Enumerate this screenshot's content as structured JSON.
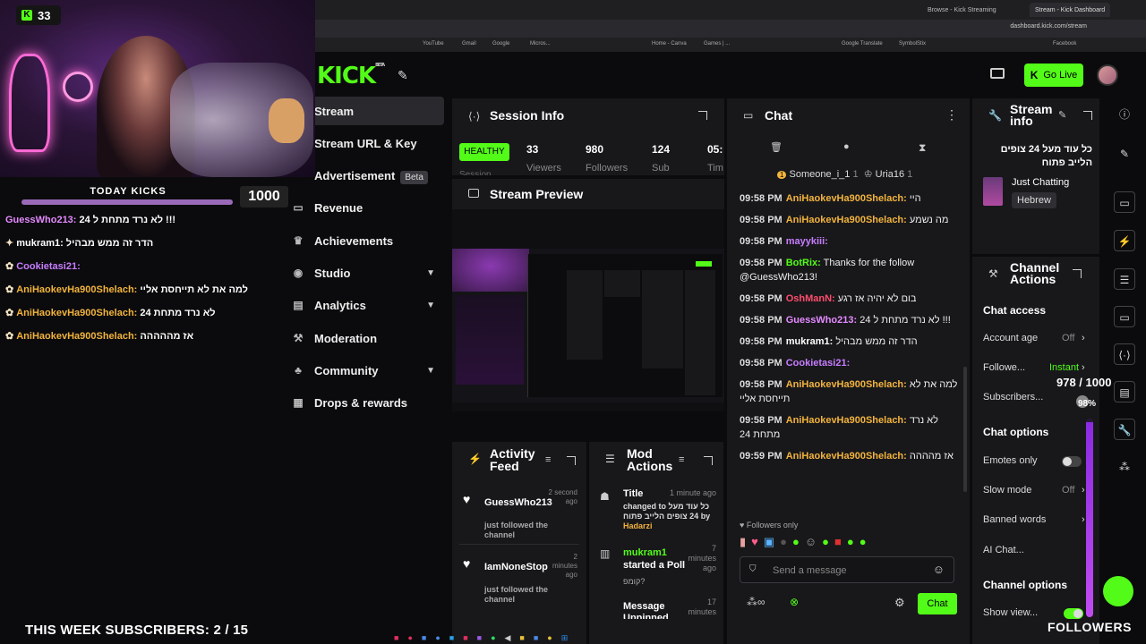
{
  "browser": {
    "tabs": [
      {
        "label": "Browse - Kick Streaming"
      },
      {
        "label": "Stream - Kick Dashboard"
      }
    ],
    "url": "dashboard.kick.com/stream",
    "bookmarks": [
      "YouTube",
      "Gmail",
      "Google",
      "Micros...",
      "Home - Canva",
      "Games | ...",
      "Google Translate",
      "SymbolStix",
      "Facebook"
    ]
  },
  "overlay": {
    "viewer_count": "33",
    "today_kicks_label": "TODAY KICKS",
    "today_kicks_value": "1000",
    "today_kicks_fraction": 1.0,
    "subs_goal": "THIS WEEK SUBSCRIBERS: 2 / 15",
    "followers_label": "FOLLOWERS",
    "followers_count": "978 / 1000",
    "followers_percent": "98%",
    "followers_fraction": 0.98,
    "chat": [
      {
        "user": "GuessWho213:",
        "text": "לא נרד מתחת ל 24 !!!",
        "color": "#e58aff",
        "badge": ""
      },
      {
        "user": "mukram1:",
        "text": "הדר זה ממש מבהיל",
        "color": "#ffffff",
        "badge": "✦"
      },
      {
        "user": "Cookietasi21:",
        "text": "",
        "color": "#c77dff",
        "badge": "✿"
      },
      {
        "user": "AniHaokevHa900Shelach:",
        "text": "למה את לא תייחסת אליי",
        "color": "#f2b33d",
        "badge": "✿"
      },
      {
        "user": "AniHaokevHa900Shelach:",
        "text": "לא נרד מתחת 24",
        "color": "#f2b33d",
        "badge": "✿"
      },
      {
        "user": "AniHaokevHa900Shelach:",
        "text": "אז מההההה",
        "color": "#f2b33d",
        "badge": "✿"
      }
    ]
  },
  "header": {
    "logo": "KICK",
    "logo_sup": "BETA",
    "go_live": "Go Live"
  },
  "sidebar": {
    "items": [
      {
        "label": "Stream",
        "icon": "stream-icon",
        "active": true
      },
      {
        "label": "Stream URL & Key",
        "icon": "key-icon"
      },
      {
        "label": "Advertisement",
        "icon": "ad-icon",
        "badge": "Beta"
      },
      {
        "label": "Revenue",
        "icon": "revenue-icon"
      },
      {
        "label": "Achievements",
        "icon": "trophy-icon"
      },
      {
        "label": "Studio",
        "icon": "studio-icon",
        "expand": true
      },
      {
        "label": "Analytics",
        "icon": "analytics-icon",
        "expand": true
      },
      {
        "label": "Moderation",
        "icon": "hammer-icon"
      },
      {
        "label": "Community",
        "icon": "community-icon",
        "expand": true
      },
      {
        "label": "Drops & rewards",
        "icon": "drops-icon"
      }
    ]
  },
  "session_info": {
    "title": "Session Info",
    "health": "HEALTHY",
    "health_sub": "Session",
    "stats": [
      {
        "value": "33",
        "label": "Viewers"
      },
      {
        "value": "980",
        "label": "Followers"
      },
      {
        "value": "124",
        "label": "Sub"
      },
      {
        "value": "05:",
        "label": "Tim"
      }
    ]
  },
  "stream_preview": {
    "title": "Stream Preview"
  },
  "activity_feed": {
    "title": "Activity Feed",
    "items": [
      {
        "user": "GuessWho213",
        "time": "2 second ago",
        "text": "just followed the channel"
      },
      {
        "user": "IamNoneStop",
        "time": "2 minutes ago",
        "text": "just followed the channel"
      }
    ]
  },
  "mod_actions": {
    "title": "Mod Actions",
    "items": [
      {
        "title": "Title",
        "time": "1 minute ago",
        "body": "changed to כל עוד מעל 24 צופים הלייב פתוח by",
        "by": "Hadarzi"
      },
      {
        "title": "mukram1",
        "title2": "started a Poll",
        "time": "7 minutes ago",
        "body": "קומפ?"
      },
      {
        "title": "Message Unpinned",
        "time": "17 minutes"
      }
    ]
  },
  "chat": {
    "title": "Chat",
    "pinned_users": [
      {
        "name": "Someone_i_1",
        "count": "1",
        "rank": "1"
      },
      {
        "name": "Uria16",
        "count": "1"
      }
    ],
    "messages": [
      {
        "time": "09:58 PM",
        "user": "AniHaokevHa900Shelach:",
        "text": "היי",
        "color": "#f2b33d"
      },
      {
        "time": "09:58 PM",
        "user": "AniHaokevHa900Shelach:",
        "text": "מה נשמע",
        "color": "#f2b33d"
      },
      {
        "time": "09:58 PM",
        "user": "mayykiii:",
        "text": "",
        "color": "#c77dff"
      },
      {
        "time": "09:58 PM",
        "user": "BotRix:",
        "text": "Thanks for the follow @GuessWho213!",
        "color": "#53fc18"
      },
      {
        "time": "09:58 PM",
        "user": "OshManN:",
        "text": "בום לא יהיה אז רגע",
        "color": "#ff4d6d"
      },
      {
        "time": "09:58 PM",
        "user": "GuessWho213:",
        "text": "לא נרד מתחת ל 24 !!!",
        "color": "#e58aff"
      },
      {
        "time": "09:58 PM",
        "user": "mukram1:",
        "text": "הדר זה ממש מבהיל",
        "color": "#ffffff"
      },
      {
        "time": "09:58 PM",
        "user": "Cookietasi21:",
        "text": "",
        "color": "#c77dff"
      },
      {
        "time": "09:58 PM",
        "user": "AniHaokevHa900Shelach:",
        "text": "למה את לא תייחסת אליי",
        "color": "#f2b33d"
      },
      {
        "time": "09:58 PM",
        "user": "AniHaokevHa900Shelach:",
        "text": "לא נרד מתחת 24",
        "color": "#f2b33d"
      },
      {
        "time": "09:59 PM",
        "user": "AniHaokevHa900Shelach:",
        "text": "אז מהההה",
        "color": "#f2b33d"
      }
    ],
    "followers_only": "Followers only",
    "placeholder": "Send a message",
    "send": "Chat"
  },
  "stream_info": {
    "title": "Stream info",
    "stream_title": "כל עוד מעל 24 צופים הלייב פתוח",
    "category": "Just Chatting",
    "language": "Hebrew"
  },
  "channel_actions": {
    "title": "Channel Actions",
    "chat_access": "Chat access",
    "account_age": "Account age",
    "account_age_value": "Off",
    "followers": "Followe...",
    "followers_value": "Instant",
    "subscribers": "Subscribers...",
    "chat_options": "Chat options",
    "emotes_only": "Emotes only",
    "slow_mode": "Slow mode",
    "slow_mode_value": "Off",
    "banned_words": "Banned words",
    "ai_chat": "AI Chat...",
    "channel_options": "Channel options",
    "show_view": "Show view..."
  },
  "colors": {
    "brand": "#53fc18",
    "panel": "#18181b",
    "background": "#0b0b0d"
  }
}
